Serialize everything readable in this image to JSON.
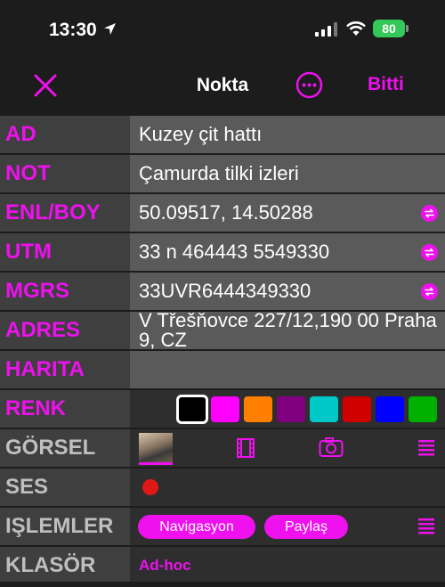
{
  "status": {
    "time": "13:30",
    "battery": "80"
  },
  "nav": {
    "title": "Nokta",
    "done": "Bitti"
  },
  "fields": {
    "name": {
      "label": "AD",
      "value": "Kuzey çit hattı"
    },
    "note": {
      "label": "NOT",
      "value": "Çamurda tilki izleri"
    },
    "latlon": {
      "label": "ENL/BOY",
      "value": "50.09517, 14.50288"
    },
    "utm": {
      "label": "UTM",
      "value": "33 n 464443 5549330"
    },
    "mgrs": {
      "label": "MGRS",
      "value": "33UVR6444349330"
    },
    "address": {
      "label": "ADRES",
      "value": "V Třešňovce 227/12,190 00 Praha 9, CZ"
    },
    "map": {
      "label": "HARITA"
    },
    "color": {
      "label": "RENK",
      "selected": "#000000",
      "swatches": [
        "#000000",
        "#ff00ff",
        "#ff8000",
        "#800080",
        "#00c8c8",
        "#d00000",
        "#0000ff",
        "#00b000"
      ]
    },
    "image": {
      "label": "GÖRSEL"
    },
    "audio": {
      "label": "SES"
    },
    "actions": {
      "label": "IŞLEMLER",
      "navigate": "Navigasyon",
      "share": "Paylaş"
    },
    "folder": {
      "label": "KLASÖR",
      "value": "Ad-hoc"
    }
  },
  "icons": {
    "close": "close-icon",
    "more": "more-icon",
    "swap": "swap-icon",
    "film": "film-icon",
    "camera": "camera-icon",
    "menu": "menu-icon"
  },
  "colors": {
    "accent": "#ee11ee",
    "record": "#e01818",
    "battery": "#34c759"
  }
}
